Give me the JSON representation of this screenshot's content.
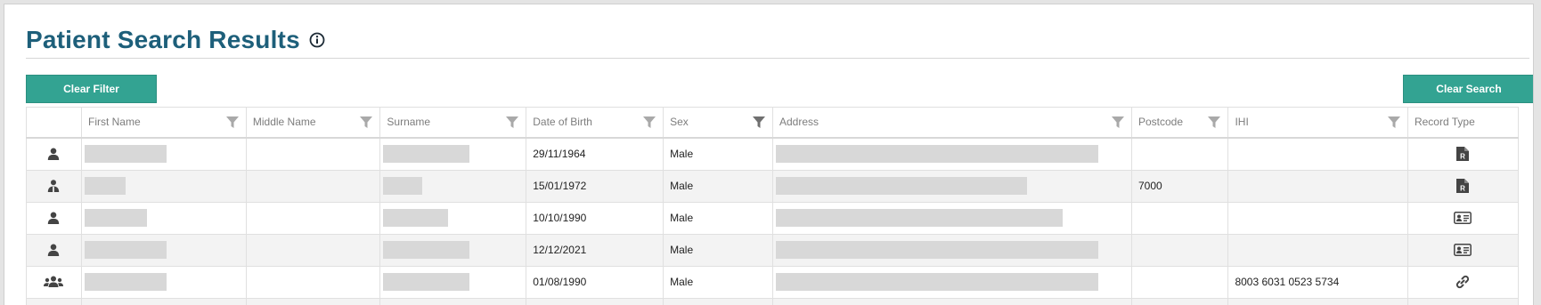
{
  "page": {
    "title": "Patient Search Results",
    "title_icon": "info-icon"
  },
  "toolbar": {
    "clear_filter_label": "Clear Filter",
    "clear_search_label": "Clear Search"
  },
  "colors": {
    "title": "#1d5f7a",
    "button": "#33a392",
    "redaction": "#d8d8d8"
  },
  "table": {
    "columns": [
      {
        "label": "",
        "filter": false
      },
      {
        "label": "First Name",
        "filter": true
      },
      {
        "label": "Middle Name",
        "filter": true
      },
      {
        "label": "Surname",
        "filter": true
      },
      {
        "label": "Date of Birth",
        "filter": true
      },
      {
        "label": "Sex",
        "filter": true,
        "filter_active": true
      },
      {
        "label": "Address",
        "filter": true
      },
      {
        "label": "Postcode",
        "filter": true
      },
      {
        "label": "IHI",
        "filter": true
      },
      {
        "label": "Record Type",
        "filter": false
      }
    ],
    "rows": [
      {
        "person_icon": "person-icon",
        "first_name": "[redacted]",
        "middle_name": "",
        "surname": "[redacted]",
        "dob": "29/11/1964",
        "sex": "Male",
        "address": "[redacted]",
        "postcode": "",
        "ihi": "",
        "record_type_icon": "prescription-document-icon"
      },
      {
        "person_icon": "person-alert-icon",
        "first_name": "[redacted]",
        "middle_name": "",
        "surname": "[redacted]",
        "dob": "15/01/1972",
        "sex": "Male",
        "address": "[redacted]",
        "postcode": "7000",
        "ihi": "",
        "record_type_icon": "prescription-document-icon"
      },
      {
        "person_icon": "person-icon",
        "first_name": "[redacted]",
        "middle_name": "",
        "surname": "[redacted]",
        "dob": "10/10/1990",
        "sex": "Male",
        "address": "[redacted]",
        "postcode": "",
        "ihi": "",
        "record_type_icon": "id-card-icon"
      },
      {
        "person_icon": "person-icon",
        "first_name": "[redacted]",
        "middle_name": "",
        "surname": "[redacted]",
        "dob": "12/12/2021",
        "sex": "Male",
        "address": "[redacted]",
        "postcode": "",
        "ihi": "",
        "record_type_icon": "id-card-icon"
      },
      {
        "person_icon": "people-group-icon",
        "first_name": "[redacted]",
        "middle_name": "",
        "surname": "[redacted]",
        "dob": "01/08/1990",
        "sex": "Male",
        "address": "[redacted]",
        "postcode": "",
        "ihi": "8003 6031 0523 5734",
        "record_type_icon": "link-icon"
      }
    ]
  }
}
